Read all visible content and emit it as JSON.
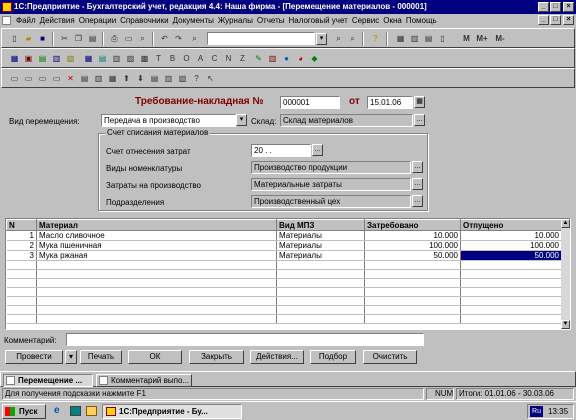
{
  "window": {
    "title": "1С:Предприятие - Бухгалтерский учет, редакция 4.4: Наша фирма - [Перемещение материалов - 000001]"
  },
  "menu": [
    "Файл",
    "Действия",
    "Операции",
    "Справочники",
    "Документы",
    "Журналы",
    "Отчеты",
    "Налоговый учет",
    "Сервис",
    "Окна",
    "Помощь"
  ],
  "toolbar": {
    "memory_buttons": [
      "M",
      "M+",
      "M-"
    ]
  },
  "doc": {
    "heading": "Требование-накладная №",
    "number": "000001",
    "from_label": "от",
    "date": "15.01.06",
    "movement_label": "Вид перемещения:",
    "movement_value": "Передача в производство",
    "warehouse_label": "Склад:",
    "warehouse_value": "Склад материалов",
    "group_title": "Счет списания материалов",
    "account_label": "Счет отнесения затрат",
    "account_value": "20 . .",
    "nomenclature_label": "Виды номенклатуры",
    "nomenclature_value": "Производство продукции",
    "costs_label": "Затраты на производство",
    "costs_value": "Материальные затраты",
    "division_label": "Подразделения",
    "division_value": "Производственный цех"
  },
  "table": {
    "headers": [
      "N",
      "Материал",
      "Вид МПЗ",
      "Затребовано",
      "Отпущено"
    ],
    "rows": [
      {
        "n": "1",
        "material": "Масло сливочное",
        "type": "Материалы",
        "requested": "10.000",
        "released": "10.000"
      },
      {
        "n": "2",
        "material": "Мука пшеничная",
        "type": "Материалы",
        "requested": "100.000",
        "released": "100.000"
      },
      {
        "n": "3",
        "material": "Мука ржаная",
        "type": "Материалы",
        "requested": "50.000",
        "released": "50.000"
      }
    ]
  },
  "comment_label": "Комментарий:",
  "buttons": {
    "post": "Провести",
    "print": "Печать",
    "ok": "ОК",
    "close": "Закрыть",
    "actions": "Действия...",
    "selection": "Подбор",
    "clear": "Очистить"
  },
  "windows_tabs": [
    "Перемещение ...",
    "Комментарий выпо..."
  ],
  "status": {
    "hint": "Для получения подсказки нажмите F1",
    "num": "NUM",
    "totals": "Итоги: 01.01.06 - 30.03.06"
  },
  "taskbar": {
    "start": "Пуск",
    "app": "1С:Предприятие - Бу...",
    "lang": "Ru",
    "time": "13:35"
  }
}
